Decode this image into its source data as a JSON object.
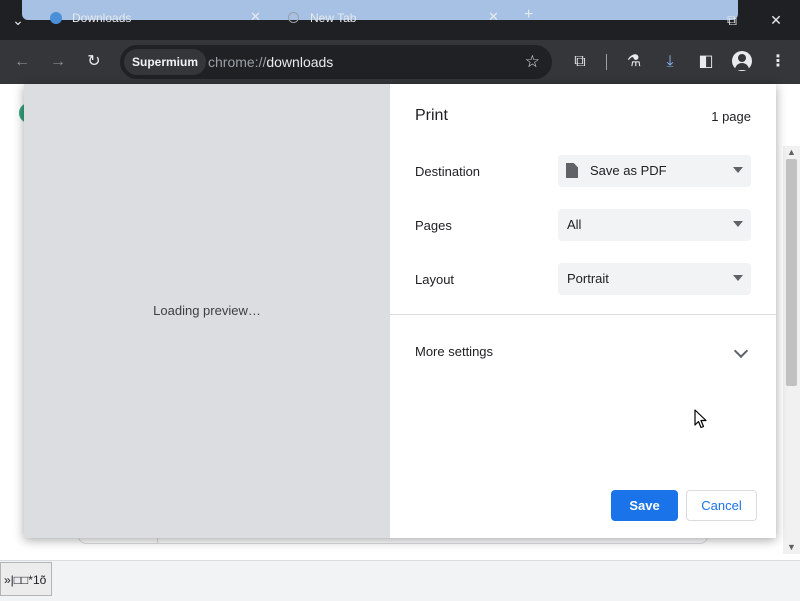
{
  "browser": {
    "tabs": [
      {
        "title": "Downloads",
        "active": true
      },
      {
        "title": "New Tab",
        "active": false
      }
    ],
    "new_tab_glyph": "+",
    "omnibox": {
      "chip_label": "Supermium",
      "url_scheme": "chrome://",
      "url_host": "downloads"
    },
    "icons": {
      "back": "arrow-left-icon",
      "forward": "arrow-right-icon",
      "reload": "reload-icon",
      "bookmark": "star-icon",
      "extensions": "puzzle-icon",
      "labs": "flask-icon",
      "downloads": "download-icon",
      "side_panel": "side-panel-icon",
      "profile": "avatar-icon",
      "menu": "kebab-menu-icon"
    }
  },
  "print_dialog": {
    "title": "Print",
    "page_count": "1 page",
    "preview_status": "Loading preview…",
    "destination": {
      "label": "Destination",
      "value": "Save as PDF"
    },
    "pages": {
      "label": "Pages",
      "value": "All"
    },
    "layout": {
      "label": "Layout",
      "value": "Portrait"
    },
    "more_settings": "More settings",
    "save_label": "Save",
    "cancel_label": "Cancel"
  },
  "bottom_bar": {
    "chip_text": "»|□□*1õ"
  },
  "colors": {
    "accent": "#1a73e8",
    "toolbar": "#35363a",
    "tabstrip": "#1f2023",
    "preview_bg": "#dcdde0"
  }
}
